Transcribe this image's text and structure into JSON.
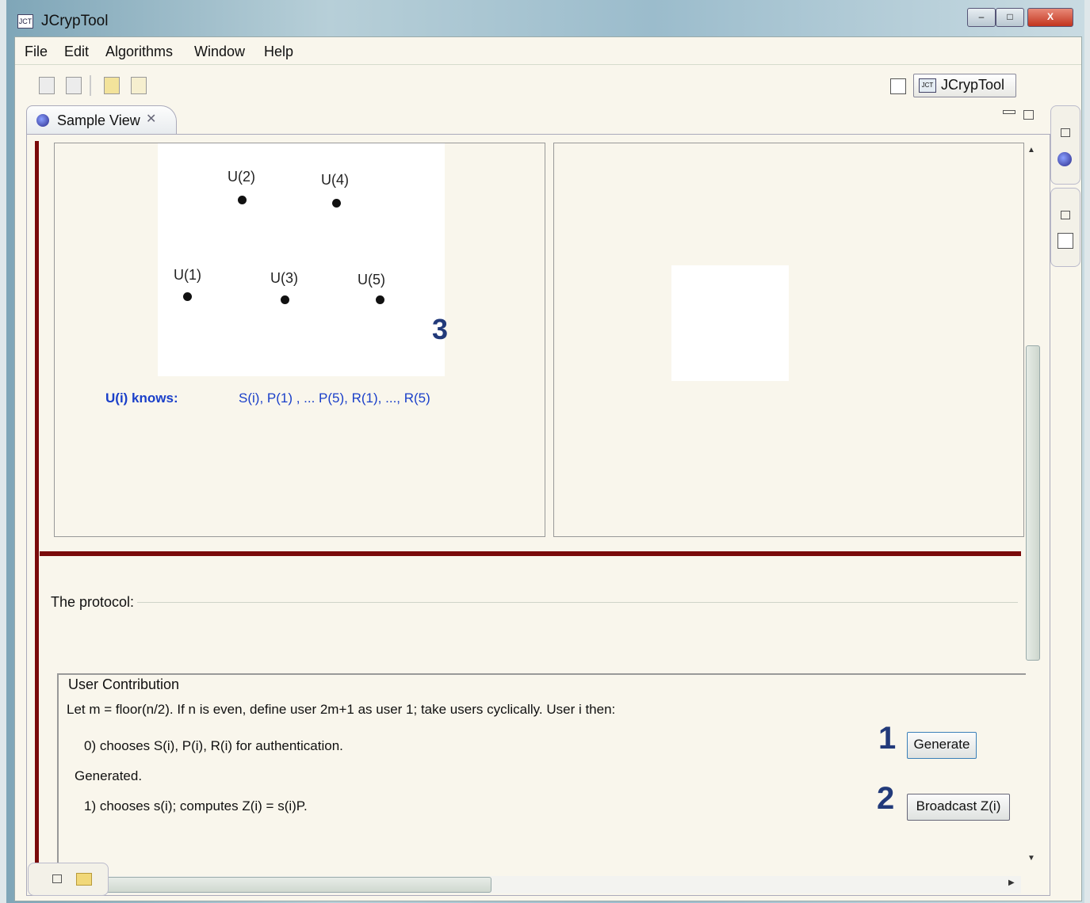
{
  "window": {
    "title": "JCrypTool",
    "icon": "jct-logo-icon",
    "controls": {
      "minimize": "–",
      "maximize": "□",
      "close": "X"
    }
  },
  "menu": [
    "File",
    "Edit",
    "Algorithms",
    "Window",
    "Help"
  ],
  "toolbar": {
    "icons": [
      "save-icon",
      "print-icon",
      "hex-icon",
      "document-icon"
    ],
    "perspective_label": "JCrypTool"
  },
  "view": {
    "tab_label": "Sample View",
    "diagram": {
      "nodes": [
        "U(2)",
        "U(4)",
        "U(1)",
        "U(3)",
        "U(5)"
      ],
      "step_marker": "3"
    },
    "knows_label": "U(i) knows:",
    "knows_value": "S(i), P(1) , ... P(5),  R(1), ..., R(5)",
    "protocol_label": "The protocol:",
    "contribution": {
      "title": "User Contribution",
      "intro": "Let m = floor(n/2). If n is even, define user 2m+1 as user 1; take users cyclically. User i then:",
      "step0": "0) chooses S(i), P(i), R(i) for authentication.",
      "generated": "Generated.",
      "step1": "1) chooses s(i); computes Z(i) = s(i)P.",
      "marker1": "1",
      "marker2": "2",
      "generate_button": "Generate",
      "broadcast_button": "Broadcast Z(i)"
    }
  }
}
